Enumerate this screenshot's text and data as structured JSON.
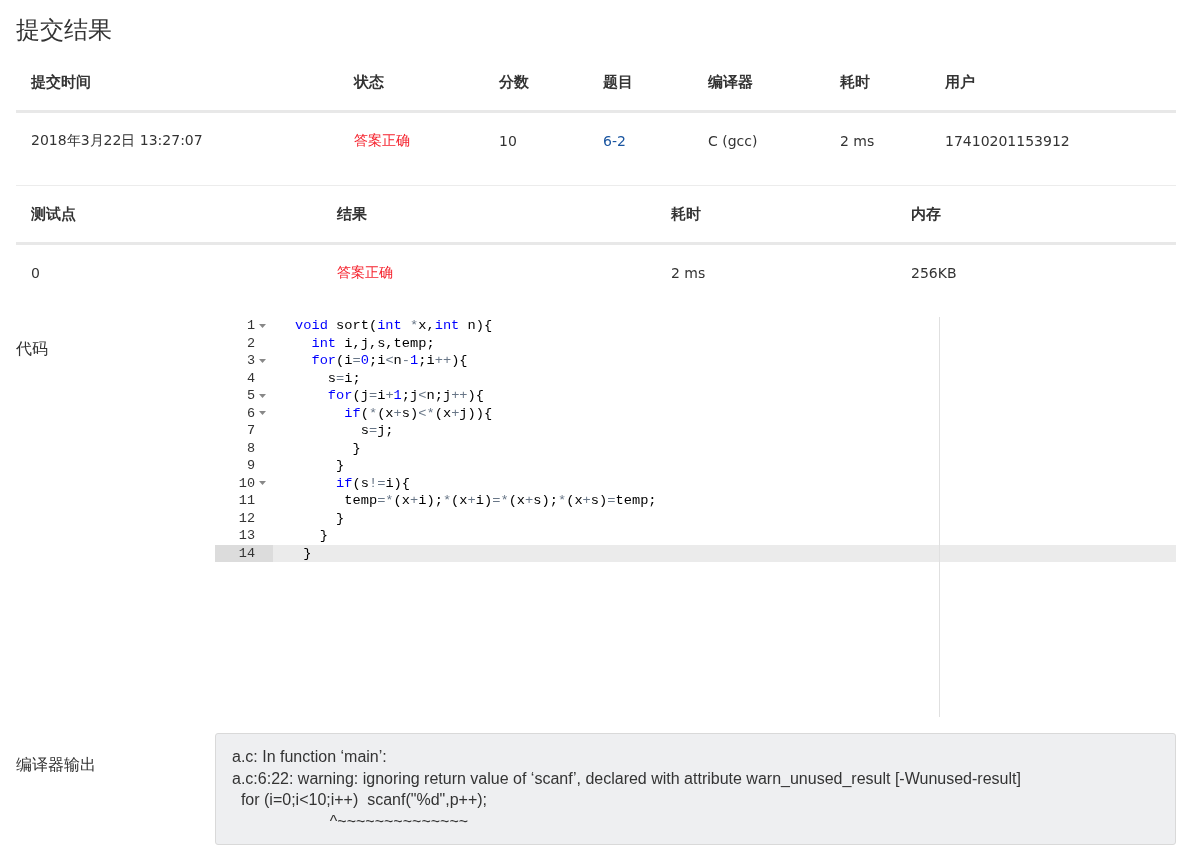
{
  "title": "提交结果",
  "submission": {
    "columns": [
      "提交时间",
      "状态",
      "分数",
      "题目",
      "编译器",
      "耗时",
      "用户"
    ],
    "row": [
      {
        "text": "2018年3月22日 13:27:07",
        "kind": "plain"
      },
      {
        "text": "答案正确",
        "kind": "status"
      },
      {
        "text": "10",
        "kind": "plain"
      },
      {
        "text": "6-2",
        "kind": "link"
      },
      {
        "text": "C (gcc)",
        "kind": "plain"
      },
      {
        "text": "2 ms",
        "kind": "plain"
      },
      {
        "text": "17410201153912",
        "kind": "plain"
      }
    ]
  },
  "tests": {
    "columns": [
      "测试点",
      "结果",
      "耗时",
      "内存"
    ],
    "rows": [
      [
        {
          "text": "0",
          "kind": "plain"
        },
        {
          "text": "答案正确",
          "kind": "status"
        },
        {
          "text": "2 ms",
          "kind": "plain"
        },
        {
          "text": "256KB",
          "kind": "plain"
        }
      ]
    ]
  },
  "code": {
    "label": "代码",
    "lines": [
      {
        "number": "1",
        "foldable": true,
        "active": false,
        "tokens": [
          {
            "text": "void",
            "kind": "keyword"
          },
          {
            "text": " sort(",
            "kind": "plain"
          },
          {
            "text": "int ",
            "kind": "keyword"
          },
          {
            "text": "*",
            "kind": "operator"
          },
          {
            "text": "x,",
            "kind": "plain"
          },
          {
            "text": "int",
            "kind": "keyword"
          },
          {
            "text": " n){",
            "kind": "plain"
          }
        ]
      },
      {
        "number": "2",
        "foldable": false,
        "active": false,
        "tokens": [
          {
            "text": "  int",
            "kind": "keyword"
          },
          {
            "text": " i,j,s,temp;",
            "kind": "plain"
          }
        ]
      },
      {
        "number": "3",
        "foldable": true,
        "active": false,
        "tokens": [
          {
            "text": "  for",
            "kind": "keyword"
          },
          {
            "text": "(i",
            "kind": "plain"
          },
          {
            "text": "=",
            "kind": "operator"
          },
          {
            "text": "0",
            "kind": "number"
          },
          {
            "text": ";i",
            "kind": "plain"
          },
          {
            "text": "<",
            "kind": "operator"
          },
          {
            "text": "n",
            "kind": "plain"
          },
          {
            "text": "-",
            "kind": "operator"
          },
          {
            "text": "1",
            "kind": "number"
          },
          {
            "text": ";i",
            "kind": "plain"
          },
          {
            "text": "++",
            "kind": "operator"
          },
          {
            "text": "){",
            "kind": "plain"
          }
        ]
      },
      {
        "number": "4",
        "foldable": false,
        "active": false,
        "tokens": [
          {
            "text": "    s",
            "kind": "plain"
          },
          {
            "text": "=",
            "kind": "operator"
          },
          {
            "text": "i;",
            "kind": "plain"
          }
        ]
      },
      {
        "number": "5",
        "foldable": true,
        "active": false,
        "tokens": [
          {
            "text": "    for",
            "kind": "keyword"
          },
          {
            "text": "(j",
            "kind": "plain"
          },
          {
            "text": "=",
            "kind": "operator"
          },
          {
            "text": "i",
            "kind": "plain"
          },
          {
            "text": "+",
            "kind": "operator"
          },
          {
            "text": "1",
            "kind": "number"
          },
          {
            "text": ";j",
            "kind": "plain"
          },
          {
            "text": "<",
            "kind": "operator"
          },
          {
            "text": "n;j",
            "kind": "plain"
          },
          {
            "text": "++",
            "kind": "operator"
          },
          {
            "text": "){",
            "kind": "plain"
          }
        ]
      },
      {
        "number": "6",
        "foldable": true,
        "active": false,
        "tokens": [
          {
            "text": "      if",
            "kind": "keyword"
          },
          {
            "text": "(",
            "kind": "plain"
          },
          {
            "text": "*",
            "kind": "operator"
          },
          {
            "text": "(x",
            "kind": "plain"
          },
          {
            "text": "+",
            "kind": "operator"
          },
          {
            "text": "s)",
            "kind": "plain"
          },
          {
            "text": "<*",
            "kind": "operator"
          },
          {
            "text": "(x",
            "kind": "plain"
          },
          {
            "text": "+",
            "kind": "operator"
          },
          {
            "text": "j)){",
            "kind": "plain"
          }
        ]
      },
      {
        "number": "7",
        "foldable": false,
        "active": false,
        "tokens": [
          {
            "text": "        s",
            "kind": "plain"
          },
          {
            "text": "=",
            "kind": "operator"
          },
          {
            "text": "j;",
            "kind": "plain"
          }
        ]
      },
      {
        "number": "8",
        "foldable": false,
        "active": false,
        "tokens": [
          {
            "text": "       }",
            "kind": "plain"
          }
        ]
      },
      {
        "number": "9",
        "foldable": false,
        "active": false,
        "tokens": [
          {
            "text": "     }",
            "kind": "plain"
          }
        ]
      },
      {
        "number": "10",
        "foldable": true,
        "active": false,
        "tokens": [
          {
            "text": "     if",
            "kind": "keyword"
          },
          {
            "text": "(s",
            "kind": "plain"
          },
          {
            "text": "!=",
            "kind": "operator"
          },
          {
            "text": "i){",
            "kind": "plain"
          }
        ]
      },
      {
        "number": "11",
        "foldable": false,
        "active": false,
        "tokens": [
          {
            "text": "      temp",
            "kind": "plain"
          },
          {
            "text": "=*",
            "kind": "operator"
          },
          {
            "text": "(x",
            "kind": "plain"
          },
          {
            "text": "+",
            "kind": "operator"
          },
          {
            "text": "i);",
            "kind": "plain"
          },
          {
            "text": "*",
            "kind": "operator"
          },
          {
            "text": "(x",
            "kind": "plain"
          },
          {
            "text": "+",
            "kind": "operator"
          },
          {
            "text": "i)",
            "kind": "plain"
          },
          {
            "text": "=*",
            "kind": "operator"
          },
          {
            "text": "(x",
            "kind": "plain"
          },
          {
            "text": "+",
            "kind": "operator"
          },
          {
            "text": "s);",
            "kind": "plain"
          },
          {
            "text": "*",
            "kind": "operator"
          },
          {
            "text": "(x",
            "kind": "plain"
          },
          {
            "text": "+",
            "kind": "operator"
          },
          {
            "text": "s)",
            "kind": "plain"
          },
          {
            "text": "=",
            "kind": "operator"
          },
          {
            "text": "temp;",
            "kind": "plain"
          }
        ]
      },
      {
        "number": "12",
        "foldable": false,
        "active": false,
        "tokens": [
          {
            "text": "     }",
            "kind": "plain"
          }
        ]
      },
      {
        "number": "13",
        "foldable": false,
        "active": false,
        "tokens": [
          {
            "text": "   }",
            "kind": "plain"
          }
        ]
      },
      {
        "number": "14",
        "foldable": false,
        "active": true,
        "tokens": [
          {
            "text": " }",
            "kind": "plain"
          }
        ]
      }
    ]
  },
  "compiler_output": {
    "label": "编译器输出",
    "lines": [
      "a.c: In function ‘main’:",
      "a.c:6:22: warning: ignoring return value of ‘scanf’, declared with attribute warn_unused_result [-Wunused-result]",
      "  for (i=0;i<10;i++)  scanf(\"%d\",p++);",
      "                      ^~~~~~~~~~~~~~~"
    ]
  }
}
